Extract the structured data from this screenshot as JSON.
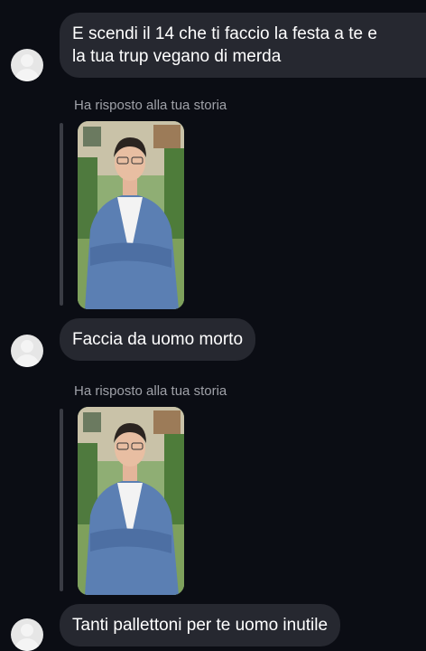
{
  "messages": [
    {
      "lines": [
        "E scendi il 14 che ti faccio la festa a te e",
        "la tua trup vegano di merda"
      ]
    },
    {
      "reply_label": "Ha risposto alla tua storia",
      "story_image": "story-photo-man-blue-blazer"
    },
    {
      "text": "Faccia da uomo morto"
    },
    {
      "reply_label": "Ha risposto alla tua storia",
      "story_image": "story-photo-man-blue-blazer"
    },
    {
      "text": "Tanti pallettoni per te uomo inutile"
    }
  ],
  "colors": {
    "background": "#0b0d14",
    "bubble": "#262830",
    "label": "#9fa1a8"
  }
}
